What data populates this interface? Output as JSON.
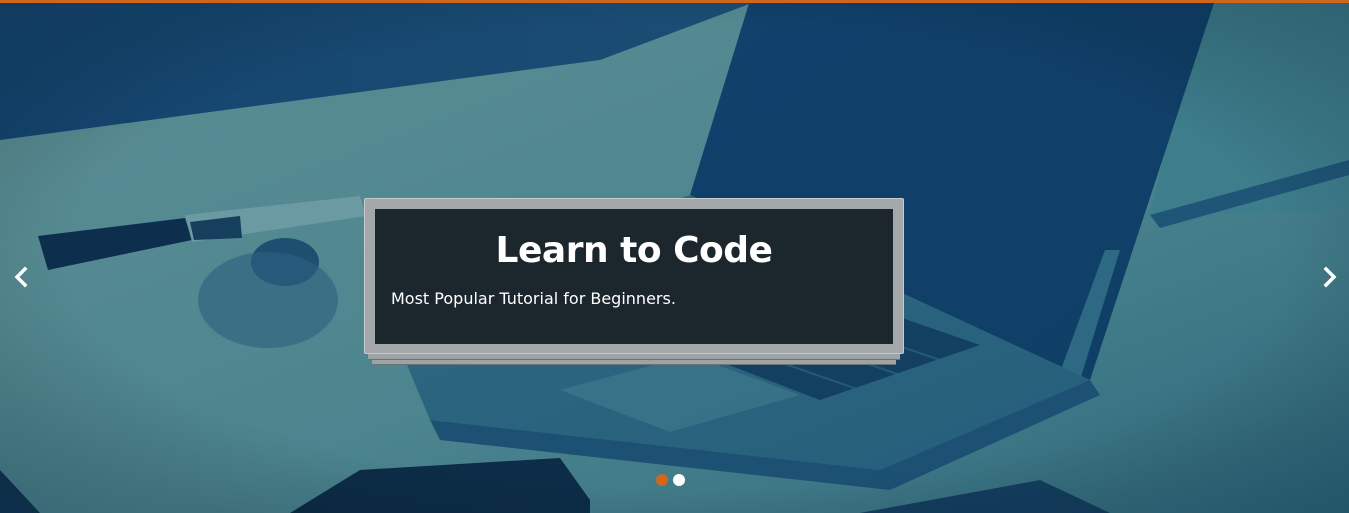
{
  "colors": {
    "accent": "#d0661c",
    "slide_tint": "#3f7a86",
    "dot_inactive": "#ffffff",
    "text": "#ffffff"
  },
  "slider": {
    "current_slide": 1,
    "slide_count": 2,
    "background_image": "laptop-desk-photo",
    "caption": {
      "title": "Learn to Code",
      "subtitle": "Most Popular Tutorial for Beginners."
    },
    "prev_icon": "chevron-left-icon",
    "next_icon": "chevron-right-icon"
  }
}
